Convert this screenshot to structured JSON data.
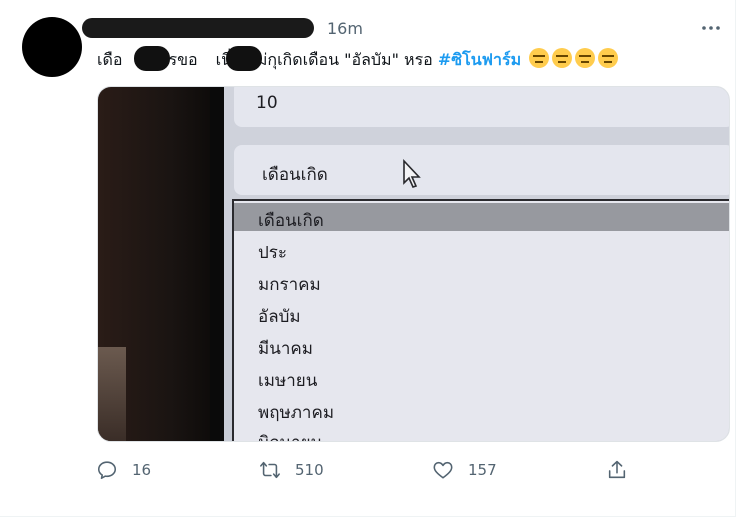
{
  "tweet": {
    "time": "16m",
    "text_before_hashtag": "เดือ",
    "text_mid1": "ไรขอ",
    "text_mid2": "เนี่ย แม่กุเกิดเดือน \"อัลบัม\" หรอ",
    "hashtag": "#ซิโนฟาร์ม",
    "emoji_icon": "expressionless-face-icon",
    "emoji_count": 4
  },
  "media": {
    "field_value": "10",
    "select_label": "เดือนเกิด",
    "dropdown_options": [
      "เดือนเกิด",
      "ประ",
      "มกราคม",
      "อัลบัม",
      "มีนาคม",
      "เมษายน",
      "พฤษภาคม",
      "มิถนายน"
    ],
    "selected_index": 0
  },
  "actions": {
    "reply_count": "16",
    "retweet_count": "510",
    "like_count": "157"
  },
  "colors": {
    "accent": "#1d9bf0",
    "muted": "#536471"
  }
}
